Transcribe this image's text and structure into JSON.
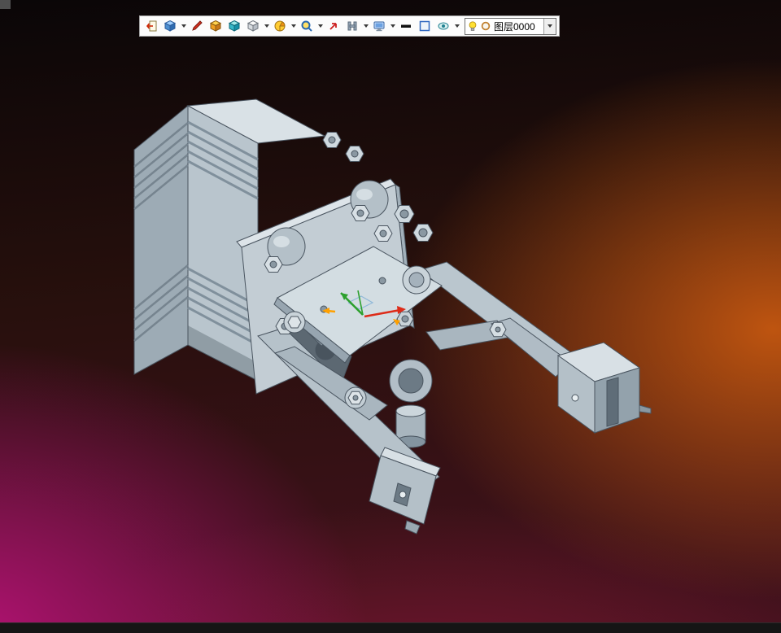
{
  "toolbar": {
    "items": [
      {
        "name": "exit-environment",
        "icon": "exit-door-icon",
        "dropdown": false
      },
      {
        "name": "isometric-view",
        "icon": "isometric-cube-icon",
        "dropdown": true
      },
      {
        "name": "sketch-tool",
        "icon": "red-pencil-icon",
        "dropdown": false
      },
      {
        "name": "solid-feature-yellow",
        "icon": "yellow-box-icon",
        "dropdown": false
      },
      {
        "name": "solid-feature-cyan",
        "icon": "cyan-box-icon",
        "dropdown": false
      },
      {
        "name": "display-cube",
        "icon": "white-cube-icon",
        "dropdown": true
      },
      {
        "name": "render-mode",
        "icon": "yellow-sphere-icon",
        "dropdown": true
      },
      {
        "name": "zoom-tool",
        "icon": "magnifier-icon",
        "dropdown": true
      },
      {
        "name": "marker-tool",
        "icon": "red-arrow-icon",
        "dropdown": false
      },
      {
        "name": "grid-tool",
        "icon": "h-grid-icon",
        "dropdown": true
      },
      {
        "name": "display-settings",
        "icon": "monitor-icon",
        "dropdown": true
      },
      {
        "name": "line-width",
        "icon": "thick-line-icon",
        "dropdown": false
      },
      {
        "name": "color-swatch",
        "icon": "swatch-icon",
        "dropdown": false
      },
      {
        "name": "shade-visibility",
        "icon": "eye-icon",
        "dropdown": true
      }
    ],
    "layer": {
      "value": "图层0000",
      "visibility_icon": "lightbulb-icon",
      "state_icon": "layer-state-circle-icon"
    }
  },
  "viewport": {
    "model_name": "pneumatic-gripper-assembly",
    "axes_colors": {
      "x": "#dd2b18",
      "y": "#2ca02c",
      "handles": "#ffa000",
      "wire": "#8fb8d8"
    },
    "model_palette": {
      "light": "#d9e1e6",
      "mid": "#b9c5cd",
      "dark": "#93a2ac",
      "darker": "#6c7a85",
      "outline": "#4a5560"
    }
  }
}
